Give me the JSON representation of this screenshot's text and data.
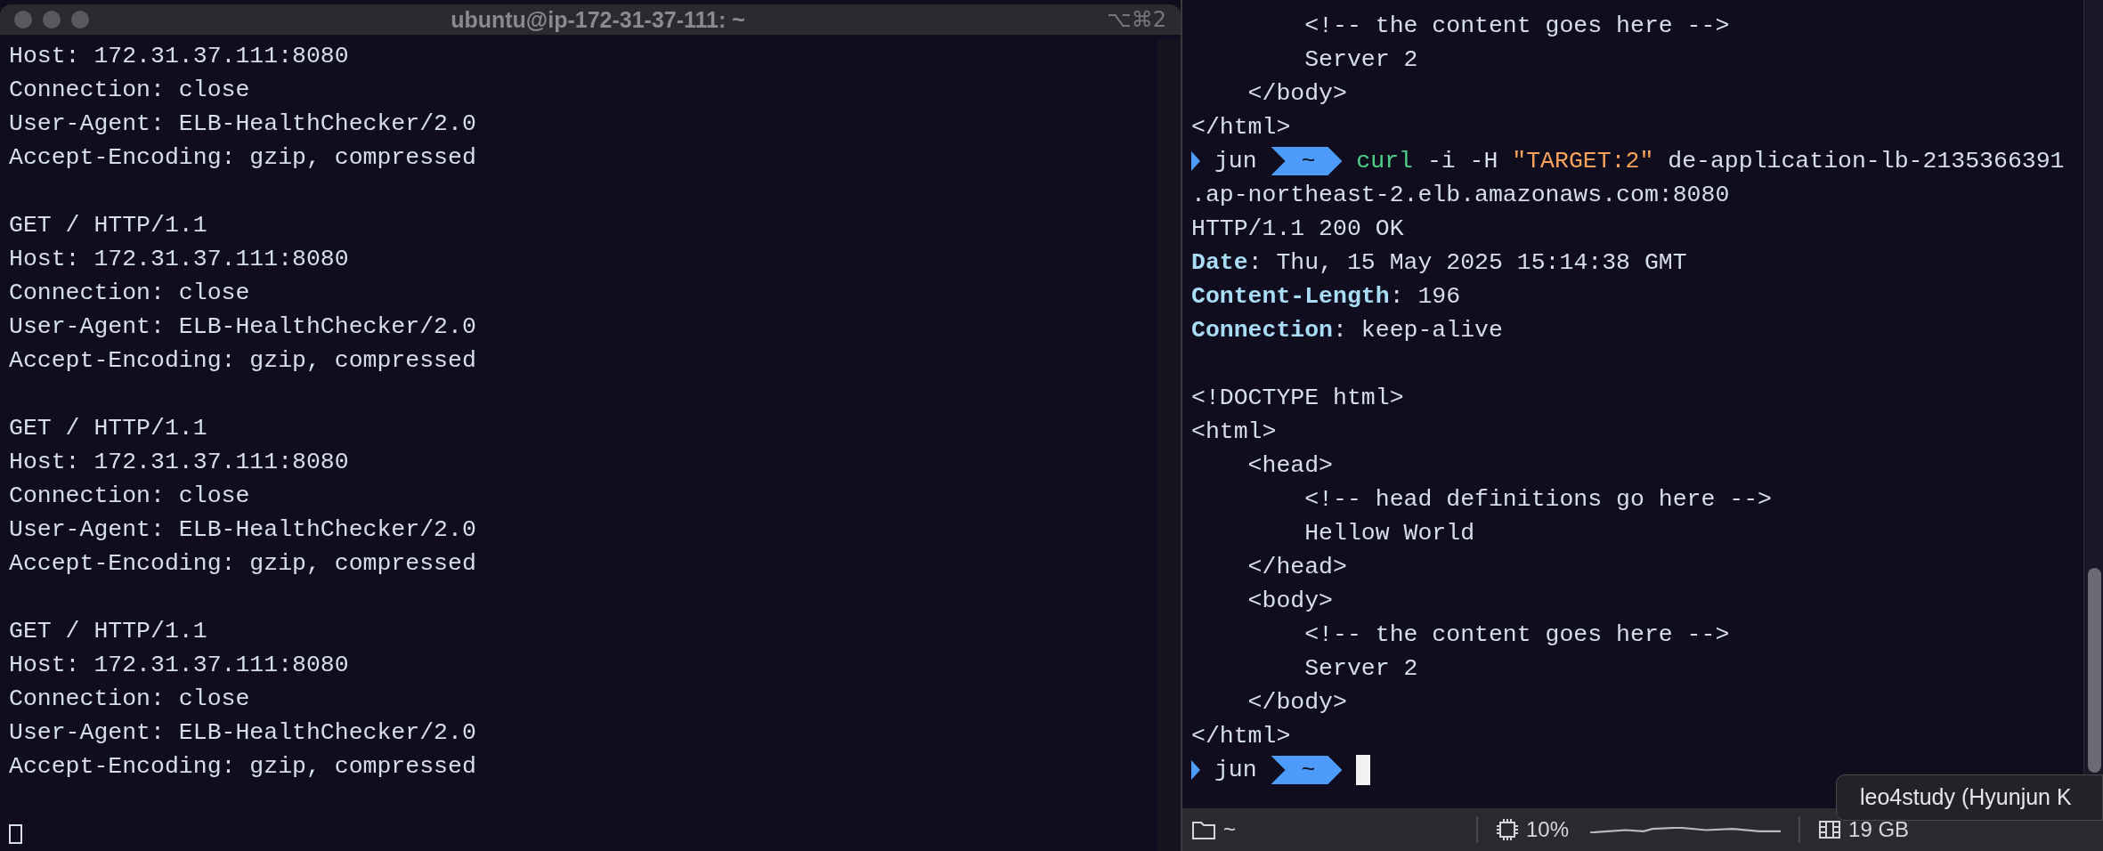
{
  "left_window": {
    "title": "ubuntu@ip-172-31-37-111: ~",
    "shortcut": "⌥⌘2",
    "lines": [
      {
        "kind": "text",
        "text": "Host: 172.31.37.111:8080"
      },
      {
        "kind": "text",
        "text": "Connection: close"
      },
      {
        "kind": "text",
        "text": "User-Agent: ELB-HealthChecker/2.0"
      },
      {
        "kind": "text",
        "text": "Accept-Encoding: gzip, compressed"
      },
      {
        "kind": "blank"
      },
      {
        "kind": "text",
        "text": "GET / HTTP/1.1"
      },
      {
        "kind": "text",
        "text": "Host: 172.31.37.111:8080"
      },
      {
        "kind": "text",
        "text": "Connection: close"
      },
      {
        "kind": "text",
        "text": "User-Agent: ELB-HealthChecker/2.0"
      },
      {
        "kind": "text",
        "text": "Accept-Encoding: gzip, compressed"
      },
      {
        "kind": "blank"
      },
      {
        "kind": "text",
        "text": "GET / HTTP/1.1"
      },
      {
        "kind": "text",
        "text": "Host: 172.31.37.111:8080"
      },
      {
        "kind": "text",
        "text": "Connection: close"
      },
      {
        "kind": "text",
        "text": "User-Agent: ELB-HealthChecker/2.0"
      },
      {
        "kind": "text",
        "text": "Accept-Encoding: gzip, compressed"
      },
      {
        "kind": "blank"
      },
      {
        "kind": "text",
        "text": "GET / HTTP/1.1"
      },
      {
        "kind": "text",
        "text": "Host: 172.31.37.111:8080"
      },
      {
        "kind": "text",
        "text": "Connection: close"
      },
      {
        "kind": "text",
        "text": "User-Agent: ELB-HealthChecker/2.0"
      },
      {
        "kind": "text",
        "text": "Accept-Encoding: gzip, compressed"
      },
      {
        "kind": "blank"
      },
      {
        "kind": "cursor"
      }
    ]
  },
  "right_pane": {
    "lines": [
      {
        "kind": "text",
        "text": "        <!-- the content goes here -->"
      },
      {
        "kind": "text",
        "text": "        Server 2"
      },
      {
        "kind": "text",
        "text": "    </body>"
      },
      {
        "kind": "text",
        "text": "</html>"
      },
      {
        "kind": "prompt",
        "user": "jun",
        "dir": "~",
        "cursor": false,
        "tokens": [
          {
            "kind": "command",
            "text": "curl"
          },
          {
            "kind": "arg",
            "text": "-i -H"
          },
          {
            "kind": "string",
            "text": "\"TARGET:2\""
          },
          {
            "kind": "arg",
            "text": "de-application-lb-2135366391"
          }
        ]
      },
      {
        "kind": "text",
        "text": ".ap-northeast-2.elb.amazonaws.com:8080"
      },
      {
        "kind": "text",
        "text": "HTTP/1.1 200 OK"
      },
      {
        "kind": "header",
        "name": "Date",
        "value": ": Thu, 15 May 2025 15:14:38 GMT"
      },
      {
        "kind": "header",
        "name": "Content-Length",
        "value": ": 196"
      },
      {
        "kind": "header",
        "name": "Connection",
        "value": ": keep-alive"
      },
      {
        "kind": "blank"
      },
      {
        "kind": "text",
        "text": "<!DOCTYPE html>"
      },
      {
        "kind": "text",
        "text": "<html>"
      },
      {
        "kind": "text",
        "text": "    <head>"
      },
      {
        "kind": "text",
        "text": "        <!-- head definitions go here -->"
      },
      {
        "kind": "text",
        "text": "        Hellow World"
      },
      {
        "kind": "text",
        "text": "    </head>"
      },
      {
        "kind": "text",
        "text": "    <body>"
      },
      {
        "kind": "text",
        "text": "        <!-- the content goes here -->"
      },
      {
        "kind": "text",
        "text": "        Server 2"
      },
      {
        "kind": "text",
        "text": "    </body>"
      },
      {
        "kind": "text",
        "text": "</html>"
      },
      {
        "kind": "prompt",
        "user": "jun",
        "dir": "~",
        "cursor": true
      }
    ]
  },
  "status_bar": {
    "directory": "~",
    "cpu": "10%",
    "memory": "19 GB"
  },
  "tooltip": "leo4study (Hyunjun K"
}
